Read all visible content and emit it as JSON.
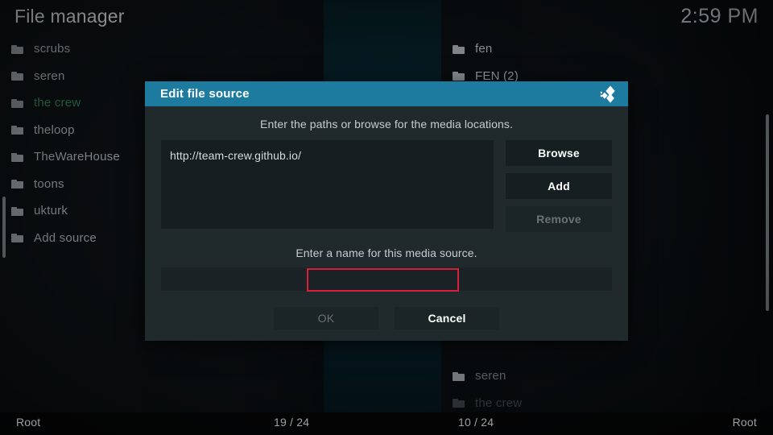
{
  "header": {
    "title": "File manager",
    "clock": "2:59 PM"
  },
  "left_panel": {
    "items": [
      {
        "label": "scrubs",
        "icon": "folder-icon",
        "state": "normal"
      },
      {
        "label": "seren",
        "icon": "folder-icon",
        "state": "normal"
      },
      {
        "label": "the crew",
        "icon": "folder-icon",
        "state": "selected"
      },
      {
        "label": "theloop",
        "icon": "folder-icon",
        "state": "normal"
      },
      {
        "label": "TheWareHouse",
        "icon": "folder-icon",
        "state": "normal"
      },
      {
        "label": "toons",
        "icon": "folder-icon",
        "state": "normal"
      },
      {
        "label": "ukturk",
        "icon": "folder-icon",
        "state": "normal"
      },
      {
        "label": "Add source",
        "icon": "folder-icon",
        "state": "normal"
      }
    ]
  },
  "right_panel": {
    "items_top": [
      {
        "label": "fen",
        "icon": "folder-icon",
        "state": "normal"
      },
      {
        "label": "FEN (2)",
        "icon": "folder-icon",
        "state": "normal"
      }
    ],
    "items_bottom": [
      {
        "label": "seren",
        "icon": "folder-icon",
        "state": "dim"
      },
      {
        "label": "the crew",
        "icon": "folder-icon",
        "state": "dim2"
      }
    ]
  },
  "statusbar": {
    "root_left": "Root",
    "count_left": "19 / 24",
    "count_right": "10 / 24",
    "root_right": "Root"
  },
  "dialog": {
    "title": "Edit file source",
    "logo_icon": "kodi-logo-icon",
    "paths_hint": "Enter the paths or browse for the media locations.",
    "paths": [
      "http://team-crew.github.io/"
    ],
    "buttons": {
      "browse": "Browse",
      "add": "Add",
      "remove": "Remove"
    },
    "name_hint": "Enter a name for this media source.",
    "name_value": "",
    "name_placeholder": "",
    "actions": {
      "ok": "OK",
      "cancel": "Cancel"
    },
    "accent_color": "#1e7ba0",
    "highlight_color": "#d8203a"
  }
}
